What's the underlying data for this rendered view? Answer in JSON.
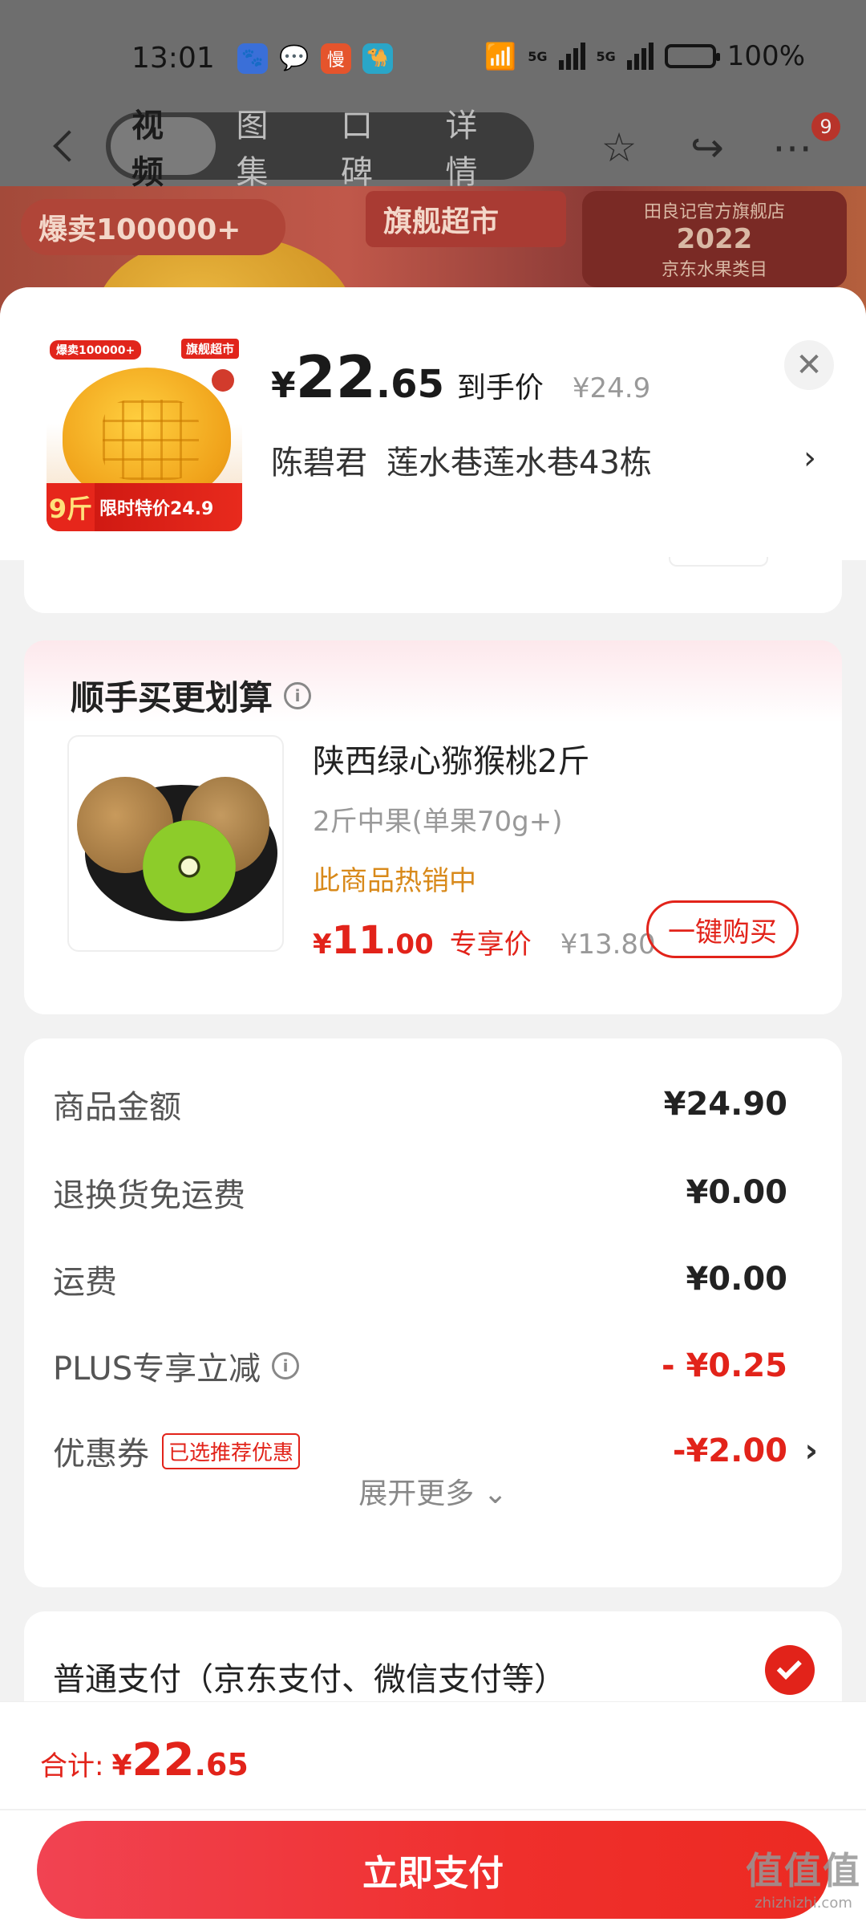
{
  "status_bar": {
    "time": "13:01",
    "battery": "100%",
    "network_1": "5G",
    "network_2": "5G",
    "app_icons": [
      "baidu-icon",
      "wechat-icon",
      "man-icon",
      "camel-icon"
    ],
    "app_icon_text": "慢"
  },
  "nav": {
    "tabs": [
      {
        "label": "视频",
        "active": true
      },
      {
        "label": "图集",
        "active": false
      },
      {
        "label": "口碑",
        "active": false
      },
      {
        "label": "详情",
        "active": false
      }
    ],
    "badge_count": "9"
  },
  "banner": {
    "tag_1": "爆卖100000+",
    "tag_2": "旗舰超市",
    "tag_3_line1": "田良记官方旗舰店",
    "tag_3_year": "2022",
    "tag_3_line2": "京东水果类目"
  },
  "header": {
    "thumb_tag_left": "爆卖100000+",
    "thumb_tag_right": "旗舰超市",
    "thumb_weight": "9斤",
    "thumb_bottom": "限时特价24.9",
    "price_yen": "¥",
    "price_int": "22",
    "price_dec": ".65",
    "price_tag": "到手价",
    "price_original": "¥24.9",
    "close_icon": "close-icon",
    "address_name": "陈碧君",
    "address_detail": "莲水巷莲水巷43栋",
    "chevron": "›"
  },
  "addon": {
    "title": "顺手买更划算",
    "info": "i",
    "product_name": "陕西绿心猕猴桃2斤",
    "spec": "2斤中果(单果70g+)",
    "hot": "此商品热销中",
    "price_yen": "¥",
    "price_int": "11",
    "price_dec": ".00",
    "price_tag": "专享价",
    "price_original": "¥13.80",
    "buy_label": "一键购买"
  },
  "summary": {
    "rows": [
      {
        "label": "商品金额",
        "value": "¥24.90"
      },
      {
        "label": "退换货免运费",
        "value": "¥0.00"
      },
      {
        "label": "运费",
        "value": "¥0.00"
      },
      {
        "label": "PLUS专享立减",
        "value": "- ¥0.25"
      },
      {
        "label": "优惠券",
        "value": "-¥2.00",
        "tag": "已选推荐优惠"
      }
    ],
    "expand_label": "展开更多 ⌄",
    "info": "i",
    "chevron": "›"
  },
  "payment": {
    "method": "普通支付（京东支付、微信支付等）",
    "selected": true
  },
  "footer": {
    "total_label": "合计:",
    "total_yen": "¥",
    "total_int": "22",
    "total_dec": ".65",
    "pay_button": "立即支付"
  },
  "watermark": {
    "main": "值值值",
    "sub": "zhizhizhi.com"
  },
  "colors": {
    "accent": "#e2231a",
    "hot": "#d8891a",
    "button_gradient_start": "#f14352"
  }
}
